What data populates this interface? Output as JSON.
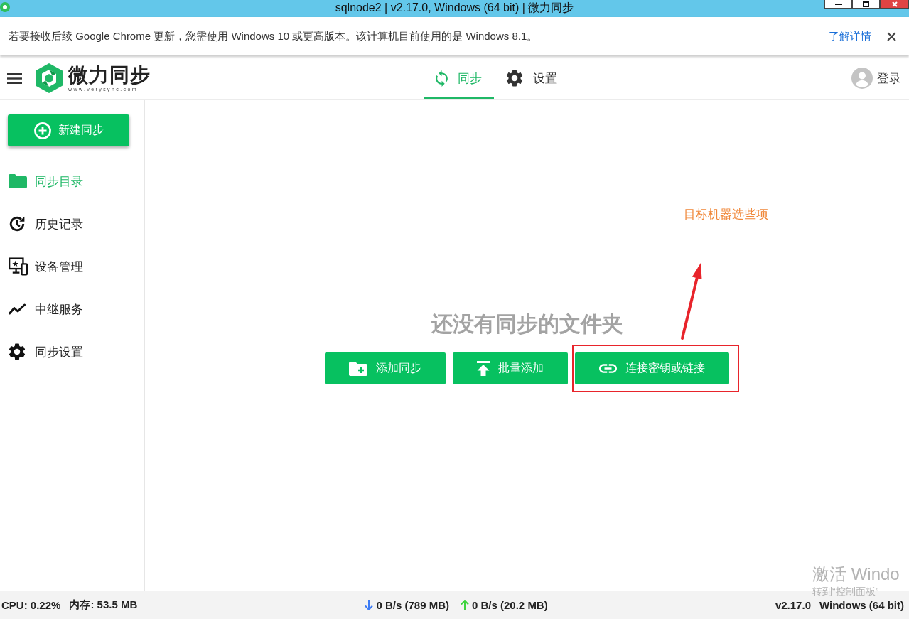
{
  "window": {
    "title": "sqlnode2 | v2.17.0, Windows (64 bit) | 微力同步"
  },
  "notice": {
    "message": "若要接收后续 Google Chrome 更新，您需使用 Windows 10 或更高版本。该计算机目前使用的是 Windows 8.1。",
    "link": "了解详情"
  },
  "header": {
    "logo_name": "微力同步",
    "logo_url": "www.verysync.com",
    "tabs": [
      {
        "label": "同步",
        "selected": true
      },
      {
        "label": "设置",
        "selected": false
      }
    ],
    "login": "登录"
  },
  "sidebar": {
    "new_button": "新建同步",
    "items": [
      {
        "label": "同步目录",
        "selected": true
      },
      {
        "label": "历史记录",
        "selected": false
      },
      {
        "label": "设备管理",
        "selected": false
      },
      {
        "label": "中继服务",
        "selected": false
      },
      {
        "label": "同步设置",
        "selected": false
      }
    ]
  },
  "main": {
    "empty_title": "还没有同步的文件夹",
    "buttons": [
      {
        "label": "添加同步",
        "highlighted": false
      },
      {
        "label": "批量添加",
        "highlighted": false
      },
      {
        "label": "连接密钥或链接",
        "highlighted": true
      }
    ],
    "annotation": "目标机器选些项"
  },
  "status_bar": {
    "cpu": "CPU: 0.22%",
    "memory": "内存: 53.5 MB",
    "download": "0 B/s (789 MB)",
    "upload": "0 B/s (20.2 MB)",
    "version": "v2.17.0",
    "platform": "Windows (64 bit)"
  },
  "activation_notice": {
    "title": "激活 Windo",
    "subtitle": "转到“控制面板”"
  }
}
